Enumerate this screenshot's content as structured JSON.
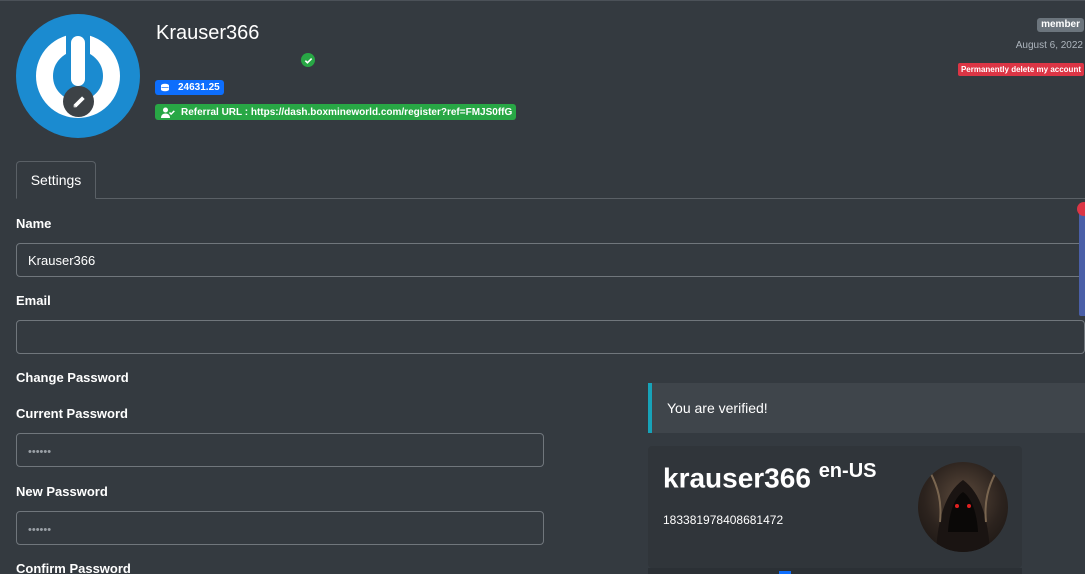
{
  "profile": {
    "username": "Krauser366",
    "credits": "24631.25",
    "referral": "Referral URL : https://dash.boxmineworld.com/register?ref=FMJS0ffG",
    "role": "member",
    "joined": "August 6, 2022",
    "delete_label": "Permanently delete my account"
  },
  "tabs": [
    {
      "label": "Settings"
    }
  ],
  "form": {
    "name_label": "Name",
    "name_value": "Krauser366",
    "email_label": "Email",
    "email_value": "",
    "change_password_heading": "Change Password",
    "current_password_label": "Current Password",
    "current_password_placeholder": "••••••",
    "new_password_label": "New Password",
    "new_password_placeholder": "••••••",
    "confirm_password_label": "Confirm Password"
  },
  "verification": {
    "message": "You are verified!"
  },
  "discord": {
    "username": "krauser366",
    "locale": "en-US",
    "id": "183381978408681472"
  },
  "colors": {
    "background": "#343a40",
    "primary": "#0d6efd",
    "success": "#28a745",
    "danger": "#dc3545",
    "info": "#17a2b8",
    "secondary": "#6c757d"
  },
  "icons": [
    "edit-pencil-icon",
    "check-circle-icon",
    "coins-icon",
    "user-check-icon"
  ]
}
